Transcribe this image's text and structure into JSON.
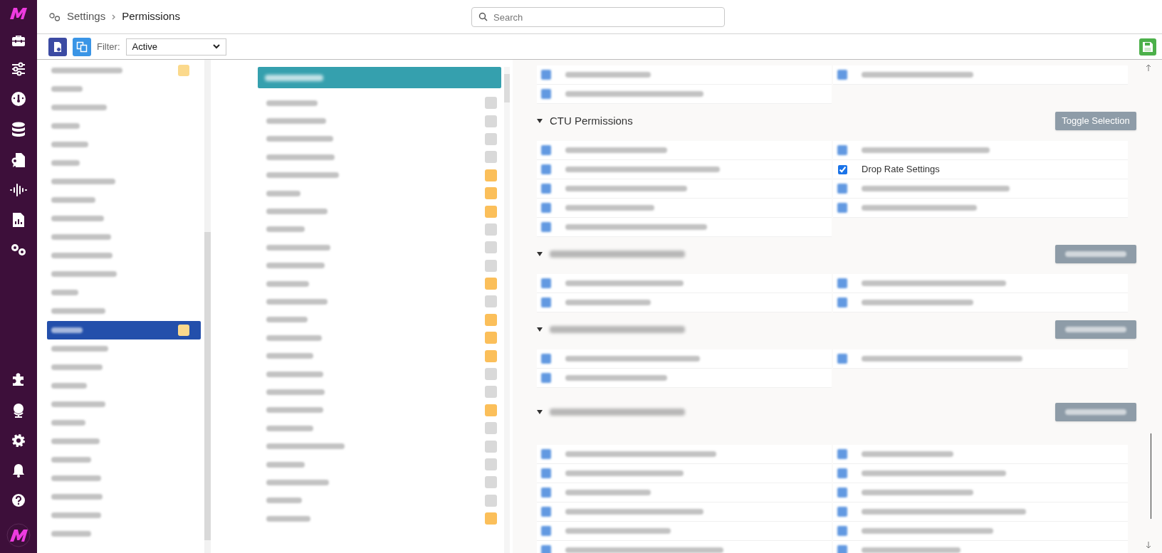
{
  "header": {
    "breadcrumb": [
      "Settings",
      "Permissions"
    ],
    "search": {
      "placeholder": "Search"
    }
  },
  "toolbar": {
    "filter_label": "Filter:",
    "filter_value": "Active"
  },
  "groups": [
    {
      "selected": false,
      "badge": true
    },
    {
      "selected": false,
      "badge": false
    },
    {
      "selected": false,
      "badge": false
    },
    {
      "selected": false,
      "badge": false
    },
    {
      "selected": false,
      "badge": false
    },
    {
      "selected": false,
      "badge": false
    },
    {
      "selected": false,
      "badge": false
    },
    {
      "selected": false,
      "badge": false
    },
    {
      "selected": false,
      "badge": false
    },
    {
      "selected": false,
      "badge": false
    },
    {
      "selected": false,
      "badge": false
    },
    {
      "selected": false,
      "badge": false
    },
    {
      "selected": false,
      "badge": false
    },
    {
      "selected": false,
      "badge": false
    },
    {
      "selected": true,
      "badge": true
    },
    {
      "selected": false,
      "badge": false
    },
    {
      "selected": false,
      "badge": false
    },
    {
      "selected": false,
      "badge": false
    },
    {
      "selected": false,
      "badge": false
    },
    {
      "selected": false,
      "badge": false
    },
    {
      "selected": false,
      "badge": false
    },
    {
      "selected": false,
      "badge": false
    },
    {
      "selected": false,
      "badge": false
    },
    {
      "selected": false,
      "badge": false
    },
    {
      "selected": false,
      "badge": false
    },
    {
      "selected": false,
      "badge": false
    }
  ],
  "users": [
    {
      "color": "#d9d9d9"
    },
    {
      "color": "#d9d9d9"
    },
    {
      "color": "#d9d9d9"
    },
    {
      "color": "#d9d9d9"
    },
    {
      "color": "#fbbf5a"
    },
    {
      "color": "#fbbf5a"
    },
    {
      "color": "#fbbf5a"
    },
    {
      "color": "#d9d9d9"
    },
    {
      "color": "#d9d9d9"
    },
    {
      "color": "#d9d9d9"
    },
    {
      "color": "#fbbf5a"
    },
    {
      "color": "#d9d9d9"
    },
    {
      "color": "#fbbf5a"
    },
    {
      "color": "#fbbf5a"
    },
    {
      "color": "#fbbf5a"
    },
    {
      "color": "#d9d9d9"
    },
    {
      "color": "#d9d9d9"
    },
    {
      "color": "#fbbf5a"
    },
    {
      "color": "#d9d9d9"
    },
    {
      "color": "#d9d9d9"
    },
    {
      "color": "#d9d9d9"
    },
    {
      "color": "#d9d9d9"
    },
    {
      "color": "#d9d9d9"
    },
    {
      "color": "#fbbf5a"
    }
  ],
  "permissions": {
    "sections": [
      {
        "items": [
          {
            "kind": "redacted"
          },
          {
            "kind": "redacted"
          },
          {
            "kind": "redacted"
          }
        ]
      },
      {
        "title": "CTU Permissions",
        "expanded": true,
        "toggle_label": "Toggle Selection",
        "items": [
          {
            "kind": "redacted"
          },
          {
            "kind": "redacted"
          },
          {
            "kind": "redacted"
          },
          {
            "kind": "checkbox",
            "label": "Drop Rate Settings",
            "checked": true
          },
          {
            "kind": "redacted"
          },
          {
            "kind": "redacted"
          },
          {
            "kind": "redacted"
          },
          {
            "kind": "redacted"
          },
          {
            "kind": "redacted"
          }
        ]
      },
      {
        "expanded": true,
        "items": [
          {
            "kind": "redacted"
          },
          {
            "kind": "redacted"
          },
          {
            "kind": "redacted"
          },
          {
            "kind": "redacted"
          }
        ]
      },
      {
        "expanded": true,
        "items": [
          {
            "kind": "redacted"
          },
          {
            "kind": "redacted"
          },
          {
            "kind": "redacted"
          }
        ]
      },
      {
        "expanded": true,
        "items": [
          {
            "kind": "redacted"
          },
          {
            "kind": "redacted"
          },
          {
            "kind": "redacted"
          },
          {
            "kind": "redacted"
          },
          {
            "kind": "redacted"
          },
          {
            "kind": "redacted"
          },
          {
            "kind": "redacted"
          },
          {
            "kind": "redacted"
          },
          {
            "kind": "redacted"
          },
          {
            "kind": "redacted"
          },
          {
            "kind": "redacted"
          },
          {
            "kind": "redacted"
          }
        ]
      }
    ]
  }
}
